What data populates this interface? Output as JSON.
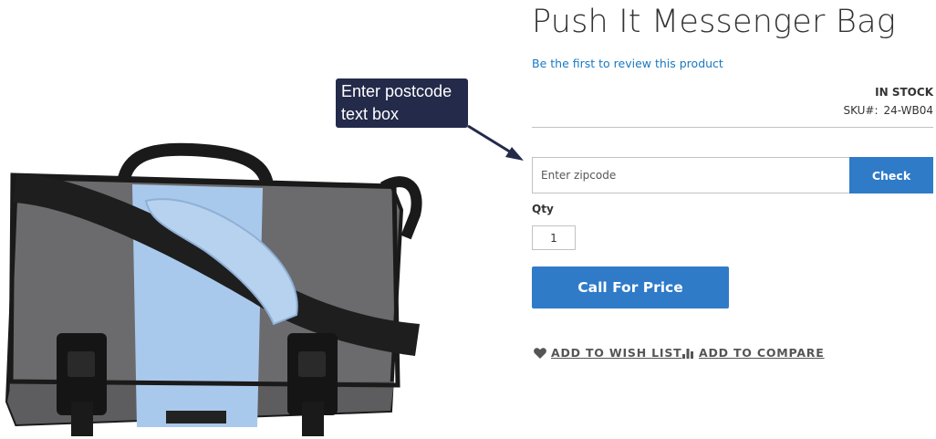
{
  "product": {
    "title": "Push It Messenger Bag",
    "review_link": "Be the first to review this product",
    "stock_status": "IN STOCK",
    "sku_label": "SKU#:",
    "sku_value": "24-WB04"
  },
  "postcode": {
    "placeholder": "Enter zipcode",
    "check_label": "Check"
  },
  "quantity": {
    "label": "Qty",
    "value": "1"
  },
  "actions": {
    "call_for_price": "Call For Price",
    "wishlist": "ADD TO WISH LIST",
    "compare": "ADD TO COMPARE"
  },
  "annotation": {
    "line1": "Enter postcode",
    "line2": "text box"
  },
  "icons": {
    "wishlist": "heart-icon",
    "compare": "bar-chart-icon"
  },
  "colors": {
    "accent": "#2f7bc8",
    "link": "#1979c3",
    "callout_bg": "#232a4a",
    "bag_gray": "#6e6e70",
    "bag_blue": "#a9c9ec"
  }
}
